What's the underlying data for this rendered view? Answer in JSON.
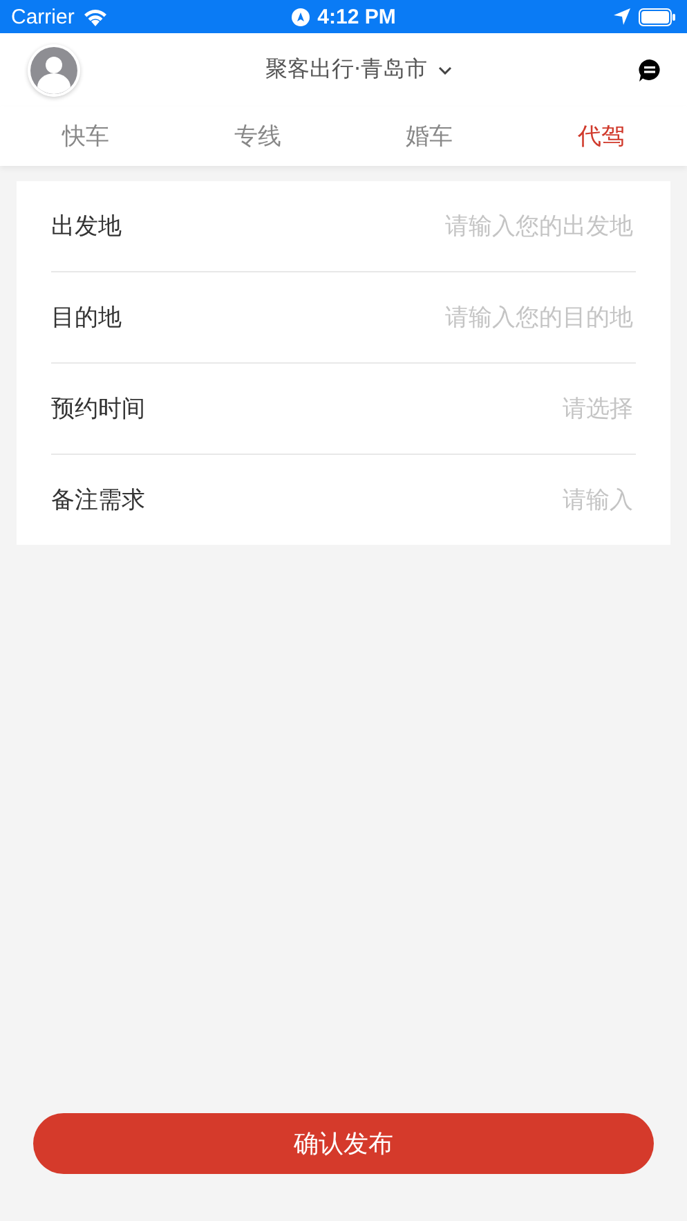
{
  "status_bar": {
    "carrier": "Carrier",
    "time": "4:12 PM"
  },
  "header": {
    "title": "聚客出行·青岛市"
  },
  "tabs": [
    {
      "label": "快车",
      "selected": false
    },
    {
      "label": "专线",
      "selected": false
    },
    {
      "label": "婚车",
      "selected": false
    },
    {
      "label": "代驾",
      "selected": true
    }
  ],
  "form": [
    {
      "label": "出发地",
      "placeholder": "请输入您的出发地"
    },
    {
      "label": "目的地",
      "placeholder": "请输入您的目的地"
    },
    {
      "label": "预约时间",
      "placeholder": "请选择"
    },
    {
      "label": "备注需求",
      "placeholder": "请输入"
    }
  ],
  "submit_button": "确认发布"
}
